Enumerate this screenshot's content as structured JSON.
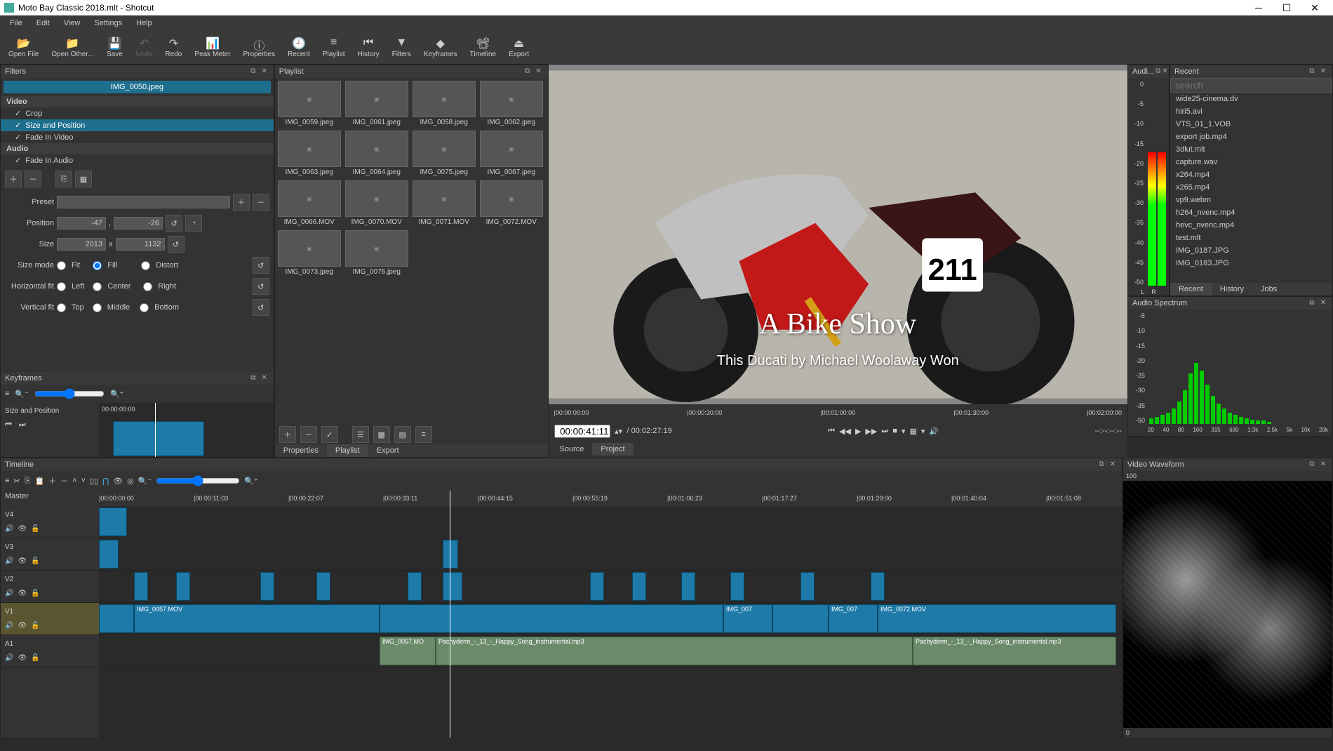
{
  "window": {
    "title": "Moto Bay Classic 2018.mlt - Shotcut"
  },
  "menubar": [
    "File",
    "Edit",
    "View",
    "Settings",
    "Help"
  ],
  "toolbar": [
    {
      "icon": "📂",
      "label": "Open File"
    },
    {
      "icon": "📁",
      "label": "Open Other..."
    },
    {
      "icon": "💾",
      "label": "Save"
    },
    {
      "icon": "↶",
      "label": "Undo",
      "disabled": true
    },
    {
      "icon": "↷",
      "label": "Redo"
    },
    {
      "icon": "📊",
      "label": "Peak Meter"
    },
    {
      "icon": "ⓘ",
      "label": "Properties"
    },
    {
      "icon": "🕘",
      "label": "Recent"
    },
    {
      "icon": "≡",
      "label": "Playlist"
    },
    {
      "icon": "⏮",
      "label": "History"
    },
    {
      "icon": "▼",
      "label": "Filters"
    },
    {
      "icon": "◆",
      "label": "Keyframes"
    },
    {
      "icon": "📽",
      "label": "Timeline"
    },
    {
      "icon": "⏏",
      "label": "Export"
    }
  ],
  "filters": {
    "title": "Filters",
    "clip": "IMG_0050.jpeg",
    "sections": {
      "video_header": "Video",
      "video_items": [
        "Crop",
        "Size and Position",
        "Fade In Video"
      ],
      "audio_header": "Audio",
      "audio_items": [
        "Fade In Audio"
      ]
    },
    "selected": "Size and Position",
    "preset_label": "Preset",
    "position_label": "Position",
    "position_x": "-47",
    "position_y": "-26",
    "size_label": "Size",
    "size_w": "2013",
    "size_x": "x",
    "size_h": "1132",
    "sizemode_label": "Size mode",
    "sizemode_opts": [
      "Fit",
      "Fill",
      "Distort"
    ],
    "hfit_label": "Horizontal fit",
    "hfit_opts": [
      "Left",
      "Center",
      "Right"
    ],
    "vfit_label": "Vertical fit",
    "vfit_opts": [
      "Top",
      "Middle",
      "Bottom"
    ]
  },
  "playlist": {
    "title": "Playlist",
    "items": [
      "IMG_0059.jpeg",
      "IMG_0061.jpeg",
      "IMG_0058.jpeg",
      "IMG_0062.jpeg",
      "IMG_0063.jpeg",
      "IMG_0064.jpeg",
      "IMG_0075.jpeg",
      "IMG_0067.jpeg",
      "IMG_0066.MOV",
      "IMG_0070.MOV",
      "IMG_0071.MOV",
      "IMG_0072.MOV",
      "IMG_0073.jpeg",
      "IMG_0076.jpeg"
    ],
    "tabs": [
      "Properties",
      "Playlist",
      "Export"
    ],
    "active_tab": "Playlist"
  },
  "player": {
    "overlay_title": "A Bike Show",
    "overlay_sub": "This Ducati by Michael Woolaway Won",
    "ruler_marks": [
      "00:00:00:00",
      "00:00:30:00",
      "00:01:00:00",
      "00:01:30:00",
      "00:02:00:00"
    ],
    "current": "00:00:41:11",
    "total": "/ 00:02:27:19",
    "tabs": [
      "Source",
      "Project"
    ],
    "active_tab": "Project",
    "tc_right": "--:--:--:--"
  },
  "audio_panel": {
    "title": "Audi...",
    "scale": [
      "0",
      "-5",
      "-10",
      "-15",
      "-20",
      "-25",
      "-30",
      "-35",
      "-40",
      "-45",
      "-50"
    ],
    "lr": [
      "L",
      "R"
    ]
  },
  "recent": {
    "title": "Recent",
    "search_placeholder": "search",
    "items": [
      "wide25-cinema.dv",
      "hiri5.avi",
      "VTS_01_1.VOB",
      "export job.mp4",
      "3dlut.mlt",
      "capture.wav",
      "x264.mp4",
      "x265.mp4",
      "vp9.webm",
      "h264_nvenc.mp4",
      "hevc_nvenc.mp4",
      "test.mlt",
      "IMG_0187.JPG",
      "IMG_0183.JPG"
    ],
    "tabs": [
      "Recent",
      "History",
      "Jobs"
    ]
  },
  "spectrum": {
    "title": "Audio Spectrum",
    "scale": [
      "-5",
      "-10",
      "-15",
      "-20",
      "-25",
      "-30",
      "-35",
      "-50"
    ],
    "freq": [
      "20",
      "40",
      "80",
      "160",
      "315",
      "630",
      "1.3k",
      "2.5k",
      "5k",
      "10k",
      "20k"
    ]
  },
  "keyframes": {
    "title": "Keyframes",
    "track_label": "Size and Position",
    "tc": "00:00:00:00"
  },
  "timeline": {
    "title": "Timeline",
    "master": "Master",
    "ruler": [
      "00:00:00:00",
      "00:00:11:03",
      "00:00:22:07",
      "00:00:33:11",
      "00:00:44:15",
      "00:00:55:19",
      "00:01:06:23",
      "00:01:17:27",
      "00:01:29:00",
      "00:01:40:04",
      "00:01:51:08"
    ],
    "tracks": [
      "V4",
      "V3",
      "V2",
      "V1",
      "A1"
    ],
    "clips_v1": [
      "IMG_0057.MOV",
      "IMG_007",
      "IMG_007",
      "IMG_0072.MOV"
    ],
    "clip_a1_1": "IMG_0057.MO",
    "clip_a1_2": "Pachyderm_-_13_-_Happy_Song_instrumental.mp3",
    "clip_a1_3": "Pachyderm_-_13_-_Happy_Song_instrumental.mp3"
  },
  "waveform": {
    "title": "Video Waveform",
    "scale_top": "100",
    "scale_bottom": "0"
  }
}
